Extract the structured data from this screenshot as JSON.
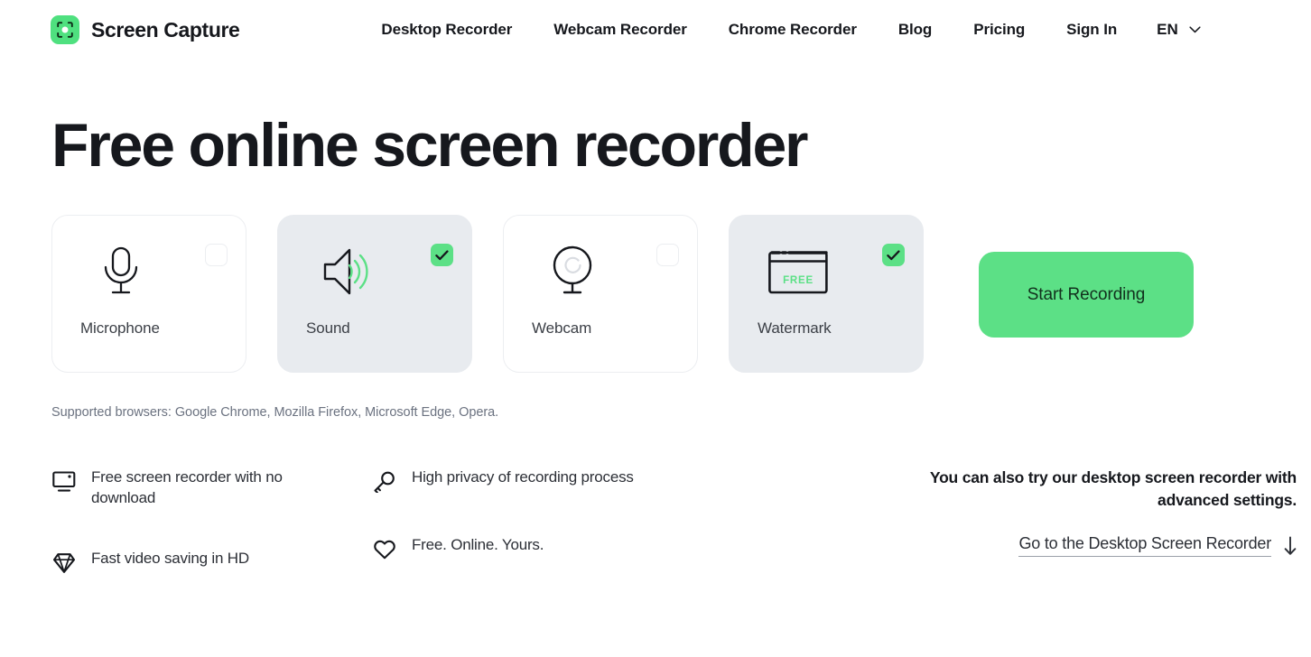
{
  "header": {
    "brand": {
      "name": "Screen Capture",
      "logo_icon": "screen-capture-logo-icon",
      "logo_color": "#4fe07f"
    },
    "nav": [
      {
        "label": "Desktop Recorder",
        "name": "nav-item-desktop-recorder"
      },
      {
        "label": "Webcam Recorder",
        "name": "nav-item-webcam-recorder"
      },
      {
        "label": "Chrome Recorder",
        "name": "nav-item-chrome-recorder"
      },
      {
        "label": "Blog",
        "name": "nav-item-blog"
      },
      {
        "label": "Pricing",
        "name": "nav-item-pricing"
      },
      {
        "label": "Sign In",
        "name": "nav-item-sign-in"
      }
    ],
    "language": {
      "label": "EN",
      "chevron_icon": "chevron-down-icon"
    }
  },
  "hero": {
    "title": "Free online screen recorder"
  },
  "recorder": {
    "options": [
      {
        "label": "Microphone",
        "icon": "microphone-icon",
        "checked": false,
        "active": false
      },
      {
        "label": "Sound",
        "icon": "speaker-sound-icon",
        "checked": true,
        "active": true
      },
      {
        "label": "Webcam",
        "icon": "webcam-icon",
        "checked": false,
        "active": false
      },
      {
        "label": "Watermark",
        "icon": "watermark-window-icon",
        "checked": true,
        "active": true,
        "badge_text": "FREE"
      }
    ],
    "start_button": {
      "label": "Start Recording",
      "color": "#5ce086"
    },
    "supported_browsers": "Supported browsers: Google Chrome, Mozilla Firefox, Microsoft Edge, Opera."
  },
  "features": {
    "column_one": [
      {
        "text": "Free screen recorder with no download",
        "icon": "monitor-icon"
      },
      {
        "text": "Fast video saving in HD",
        "icon": "diamond-icon"
      }
    ],
    "column_two": [
      {
        "text": "High privacy of recording process",
        "icon": "key-icon"
      },
      {
        "text": "Free. Online. Yours.",
        "icon": "heart-icon"
      }
    ]
  },
  "desktop_promo": {
    "text": "You can also try our desktop screen recorder with advanced settings.",
    "link_label": "Go to the Desktop Screen Recorder",
    "arrow_icon": "arrow-down-icon"
  },
  "theme": {
    "accent_green": "#5ce086",
    "card_active_bg": "#e8ebef",
    "text_dark": "#16181d",
    "text_muted": "#6b7280"
  }
}
